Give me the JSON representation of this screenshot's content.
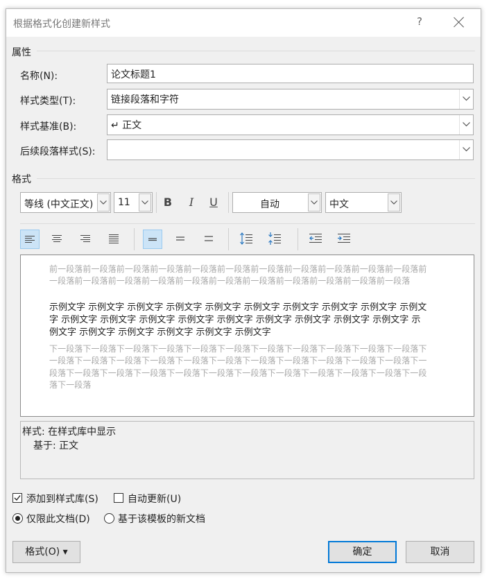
{
  "window": {
    "title": "根据格式化创建新样式",
    "help": "?"
  },
  "properties": {
    "heading": "属性",
    "name_label": "名称(N):",
    "name_value": "论文标题1",
    "type_label": "样式类型(T):",
    "type_value": "链接段落和字符",
    "base_label": "样式基准(B):",
    "base_value": "↵ 正文",
    "next_label": "后续段落样式(S):",
    "next_value": ""
  },
  "format": {
    "heading": "格式",
    "font": "等线 (中文正文)",
    "size": "11",
    "bold": "B",
    "italic": "I",
    "underline": "U",
    "color": "自动",
    "script": "中文"
  },
  "preview": {
    "before": "前一段落前一段落前一段落前一段落前一段落前一段落前一段落前一段落前一段落前一段落前一段落前一段落前一段落前一段落前一段落前一段落前一段落前一段落前一段落前一段落前一段落前一段落",
    "sample": "示例文字 示例文字 示例文字 示例文字 示例文字 示例文字 示例文字 示例文字 示例文字 示例文字 示例文字 示例文字 示例文字 示例文字 示例文字 示例文字 示例文字 示例文字 示例文字 示例文字 示例文字 示例文字 示例文字 示例文字 示例文字",
    "after": "下一段落下一段落下一段落下一段落下一段落下一段落下一段落下一段落下一段落下一段落下一段落下一段落下一段落下一段落下一段落下一段落下一段落下一段落下一段落下一段落下一段落下一段落下一段落下一段落下一段落下一段落下一段落下一段落下一段落下一段落下一段落下一段落下一段落下一段落下一段落"
  },
  "description": {
    "line1": "样式: 在样式库中显示",
    "line2": "基于: 正文"
  },
  "options": {
    "add_to_gallery": "添加到样式库(S)",
    "auto_update": "自动更新(U)",
    "only_this_doc": "仅限此文档(D)",
    "new_docs_template": "基于该模板的新文档"
  },
  "buttons": {
    "format": "格式(O) ▾",
    "ok": "确定",
    "cancel": "取消"
  },
  "colors": {
    "accent": "#0078d7",
    "selected_bg": "#cce4f7"
  }
}
